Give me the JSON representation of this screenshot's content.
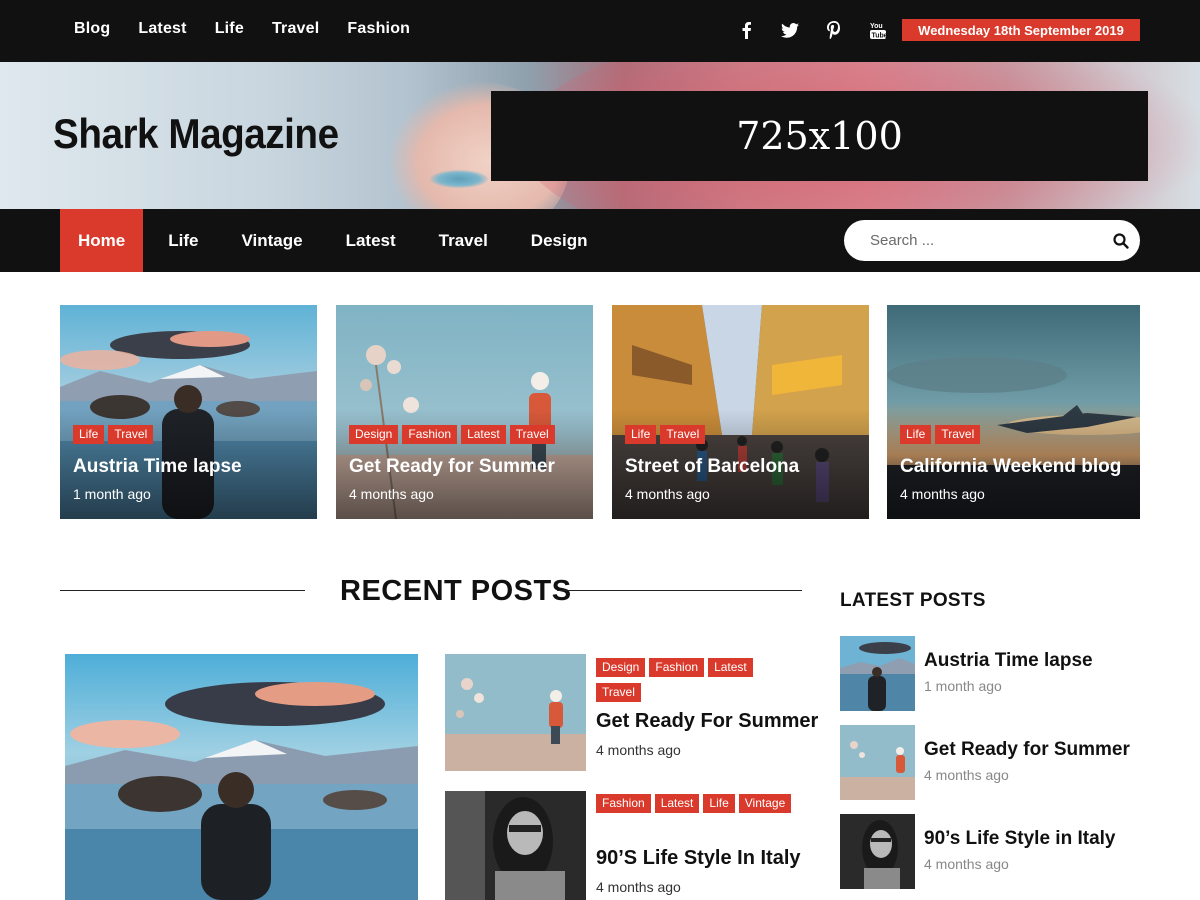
{
  "topbar": {
    "links": [
      "Blog",
      "Latest",
      "Life",
      "Travel",
      "Fashion"
    ],
    "socials": [
      "facebook-icon",
      "twitter-icon",
      "pinterest-icon",
      "youtube-icon"
    ],
    "date": "Wednesday 18th September 2019"
  },
  "header": {
    "site_title": "Shark Magazine",
    "ad_text": "725x100"
  },
  "nav": {
    "items": [
      "Home",
      "Life",
      "Vintage",
      "Latest",
      "Travel",
      "Design"
    ],
    "active": "Home",
    "search_placeholder": "Search ..."
  },
  "featured": [
    {
      "tags": [
        "Life",
        "Travel"
      ],
      "title": "Austria Time lapse",
      "date": "1 month ago"
    },
    {
      "tags": [
        "Design",
        "Fashion",
        "Latest",
        "Travel"
      ],
      "title": "Get Ready for Summer",
      "date": "4 months ago"
    },
    {
      "tags": [
        "Life",
        "Travel"
      ],
      "title": "Street of Barcelona",
      "date": "4 months ago"
    },
    {
      "tags": [
        "Life",
        "Travel"
      ],
      "title": "California Weekend blog",
      "date": "4 months ago"
    }
  ],
  "recent": {
    "heading": "RECENT POSTS",
    "posts": [
      {
        "tags": [
          "Design",
          "Fashion",
          "Latest",
          "Travel"
        ],
        "title": "Get Ready For Summer",
        "date": "4 months ago"
      },
      {
        "tags": [
          "Fashion",
          "Latest",
          "Life",
          "Vintage"
        ],
        "title": "90’S Life Style In Italy",
        "date": "4 months ago"
      }
    ]
  },
  "sidebar": {
    "heading": "LATEST POSTS",
    "posts": [
      {
        "title": "Austria Time lapse",
        "date": "1 month ago"
      },
      {
        "title": "Get Ready for Summer",
        "date": "4 months ago"
      },
      {
        "title": "90’s Life Style in Italy",
        "date": "4 months ago"
      }
    ]
  },
  "colors": {
    "accent": "#d93a2b",
    "dark": "#111111"
  }
}
